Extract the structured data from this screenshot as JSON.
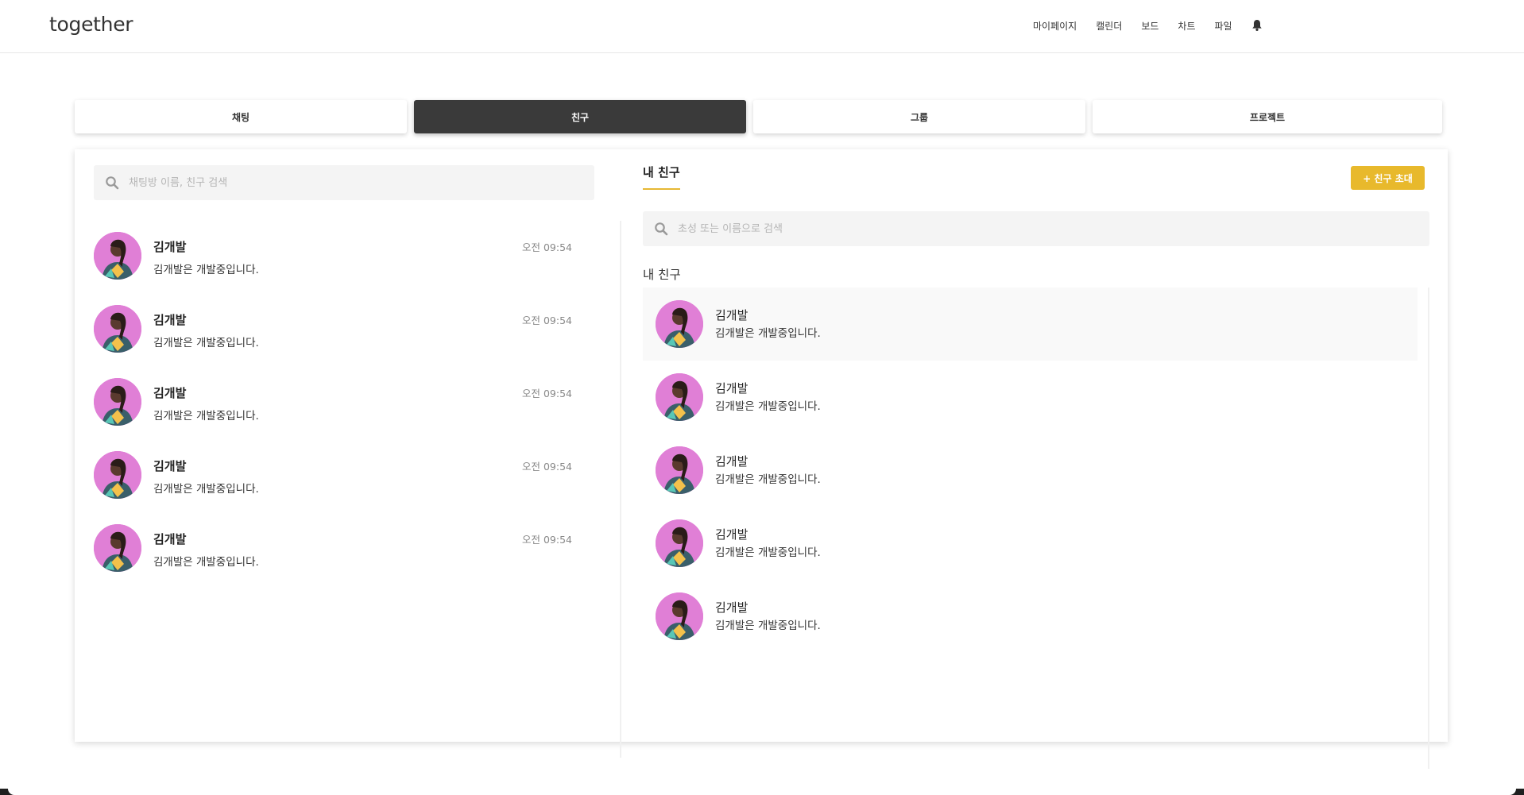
{
  "header": {
    "logo": "together",
    "nav": [
      "마이페이지",
      "캘린더",
      "보드",
      "차트",
      "파일"
    ],
    "bell_icon": "bell-icon"
  },
  "tabs": [
    {
      "label": "채팅",
      "active": false
    },
    {
      "label": "친구",
      "active": true
    },
    {
      "label": "그룹",
      "active": false
    },
    {
      "label": "프로젝트",
      "active": false
    }
  ],
  "chat_panel": {
    "search_placeholder": "채팅방 이름, 친구 검색",
    "items": [
      {
        "name": "김개발",
        "message": "김개발은 개발중입니다.",
        "time": "오전 09:54"
      },
      {
        "name": "김개발",
        "message": "김개발은 개발중입니다.",
        "time": "오전 09:54"
      },
      {
        "name": "김개발",
        "message": "김개발은 개발중입니다.",
        "time": "오전 09:54"
      },
      {
        "name": "김개발",
        "message": "김개발은 개발중입니다.",
        "time": "오전 09:54"
      },
      {
        "name": "김개발",
        "message": "김개발은 개발중입니다.",
        "time": "오전 09:54"
      }
    ]
  },
  "friends_panel": {
    "tab_label": "내 친구",
    "invite_button": "+ 친구 초대",
    "search_placeholder": "초성 또는 이름으로 검색",
    "heading": "내 친구",
    "items": [
      {
        "name": "김개발",
        "status": "김개발은 개발중입니다."
      },
      {
        "name": "김개발",
        "status": "김개발은 개발중입니다."
      },
      {
        "name": "김개발",
        "status": "김개발은 개발중입니다."
      },
      {
        "name": "김개발",
        "status": "김개발은 개발중입니다."
      },
      {
        "name": "김개발",
        "status": "김개발은 개발중입니다."
      }
    ]
  },
  "colors": {
    "accent": "#e8b92c",
    "active_tab": "#3a3a3a",
    "avatar_bg": "#e07fd6"
  }
}
